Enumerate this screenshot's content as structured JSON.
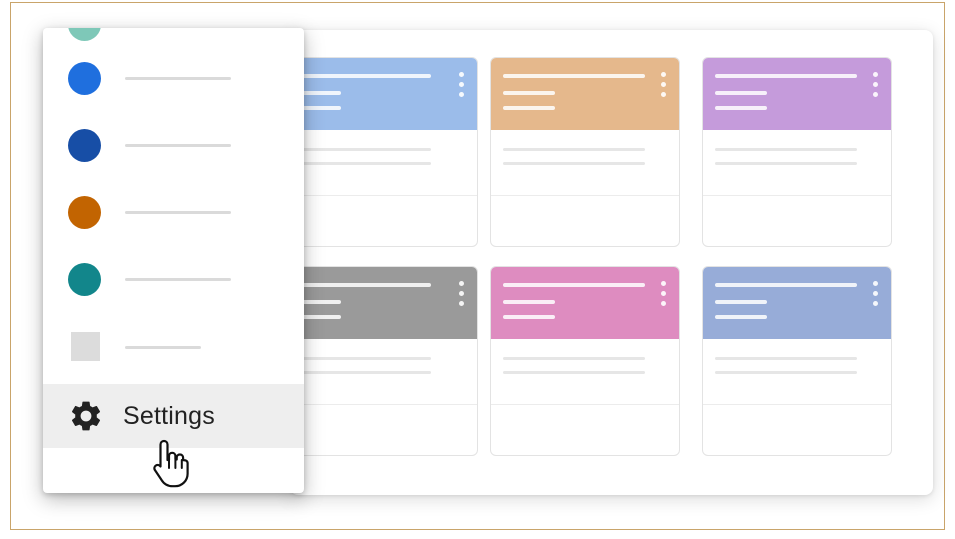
{
  "menu": {
    "items": [
      {
        "kind": "color",
        "color": "#7ec8b8"
      },
      {
        "kind": "color",
        "color": "#1f6fde"
      },
      {
        "kind": "color",
        "color": "#174ea6"
      },
      {
        "kind": "color",
        "color": "#c26401"
      },
      {
        "kind": "color",
        "color": "#12868b"
      },
      {
        "kind": "square",
        "color": "#dcdcdc"
      }
    ],
    "settings_label": "Settings"
  },
  "cards": [
    {
      "color": "#9bbcea"
    },
    {
      "color": "#e5b88c"
    },
    {
      "color": "#c59bdb"
    },
    {
      "color": "#9a9a9a"
    },
    {
      "color": "#de8cc0"
    },
    {
      "color": "#97acd8"
    }
  ],
  "icons": {
    "gear": "gear-icon",
    "more": "more-vert-icon",
    "cursor": "hand-pointer-icon"
  }
}
